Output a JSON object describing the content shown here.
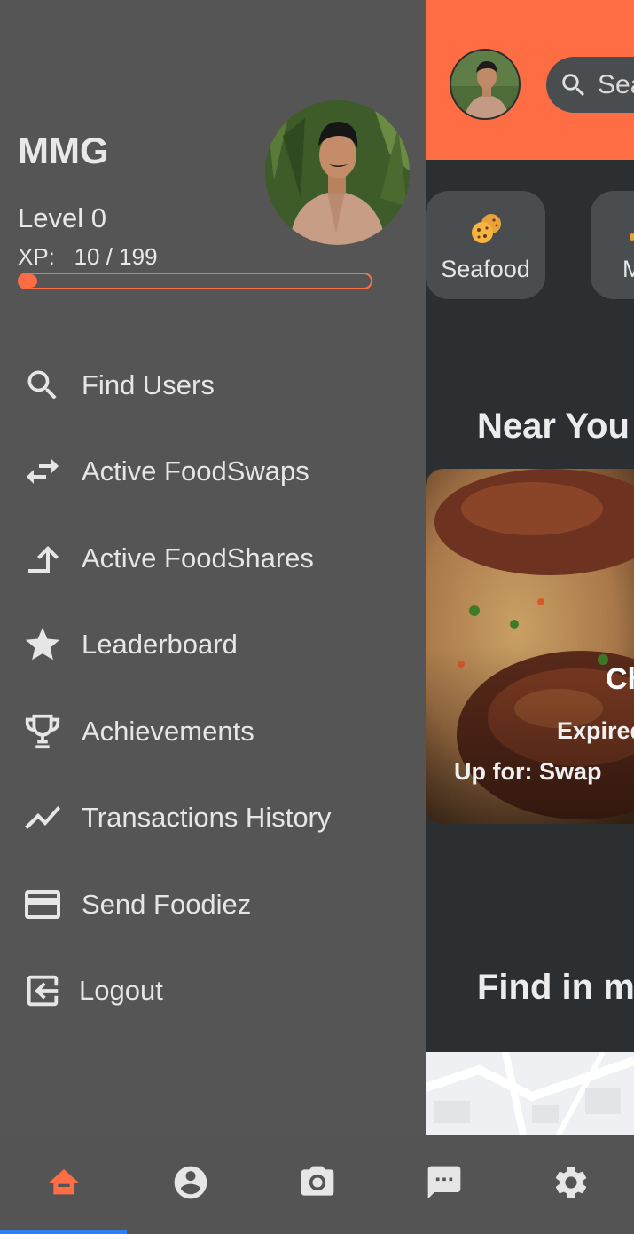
{
  "theme": {
    "accent": "#ff6d45",
    "drawer_bg": "#555555",
    "app_bg": "#2b2f31",
    "nav_bg": "#545454",
    "indicator": "#2d7ff0"
  },
  "drawer": {
    "profile": {
      "name": "MMG",
      "level": "Level 0",
      "xp_text": "XP:   10 / 199",
      "xp_progress": 0.05
    },
    "menu": [
      {
        "label": "Find Users",
        "icon": "search-icon"
      },
      {
        "label": "Active FoodSwaps",
        "icon": "swap-arrows-icon"
      },
      {
        "label": "Active FoodShares",
        "icon": "share-arrow-icon"
      },
      {
        "label": "Leaderboard",
        "icon": "star-icon"
      },
      {
        "label": "Achievements",
        "icon": "trophy-icon"
      },
      {
        "label": "Transactions History",
        "icon": "trending-line-icon"
      },
      {
        "label": "Send Foodiez",
        "icon": "credit-card-icon"
      },
      {
        "label": "Logout",
        "icon": "logout-icon"
      }
    ]
  },
  "app": {
    "search_placeholder": "Sea",
    "categories": [
      {
        "label": "Seafood",
        "icon": "cookie-icon"
      },
      {
        "label": "M"
      }
    ],
    "near_you_title": "Near You",
    "food_card": {
      "name": "Ch",
      "expires": "Expired",
      "up_for": "Up for: Swap"
    },
    "find_in_map_title": "Find in m"
  },
  "bottom_nav": [
    {
      "icon": "home-icon",
      "active": true
    },
    {
      "icon": "profile-icon",
      "active": false
    },
    {
      "icon": "camera-icon",
      "active": false
    },
    {
      "icon": "chat-icon",
      "active": false
    },
    {
      "icon": "settings-icon",
      "active": false
    }
  ]
}
